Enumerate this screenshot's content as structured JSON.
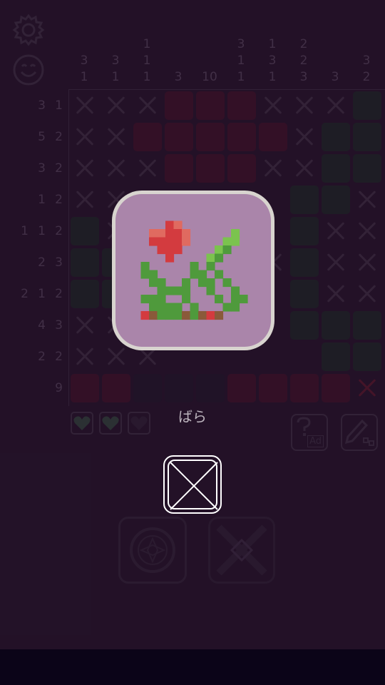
{
  "column_clues": [
    [
      "3",
      "1"
    ],
    [
      "3",
      "1"
    ],
    [
      "1",
      "1",
      "1"
    ],
    [
      "3"
    ],
    [
      "10"
    ],
    [
      "3",
      "1",
      "1"
    ],
    [
      "1",
      "3",
      "1"
    ],
    [
      "2",
      "2",
      "3"
    ],
    [
      "3"
    ],
    [
      "3",
      "2"
    ]
  ],
  "row_clues": [
    [
      "3",
      "1"
    ],
    [
      "5",
      "2"
    ],
    [
      "3",
      "2"
    ],
    [
      "1",
      "2"
    ],
    [
      "1",
      "1",
      "2"
    ],
    [
      "2",
      "3"
    ],
    [
      "2",
      "1",
      "2"
    ],
    [
      "4",
      "3"
    ],
    [
      "2",
      "2"
    ],
    [
      "9"
    ]
  ],
  "hearts": [
    {
      "icon": "heart-icon",
      "state": "full"
    },
    {
      "icon": "heart-icon",
      "state": "full"
    },
    {
      "icon": "heart-icon",
      "state": "empty"
    }
  ],
  "hint_button": {
    "icon": "question-icon",
    "badge": "Ad"
  },
  "memo_button": {
    "icon": "pencil-icon"
  },
  "result": {
    "title": "ばら",
    "image_icon": "rose-pixel-art-icon"
  },
  "close_button": {
    "icon": "close-icon"
  },
  "mode_buttons": [
    {
      "name": "fill-mode-button",
      "icon": "ornament-circle-icon"
    },
    {
      "name": "cross-mode-button",
      "icon": "ornament-x-icon"
    }
  ],
  "settings": {
    "icon": "gear-icon"
  },
  "face": {
    "icon": "smiley-icon"
  },
  "colors": {
    "background": "#1f1224",
    "red_cell": "#3c0f22",
    "green_cell": "#17271f",
    "card_bg": "#aa85aa",
    "rose_red": "#d33b3f",
    "leaf_green": "#5ba23e"
  }
}
